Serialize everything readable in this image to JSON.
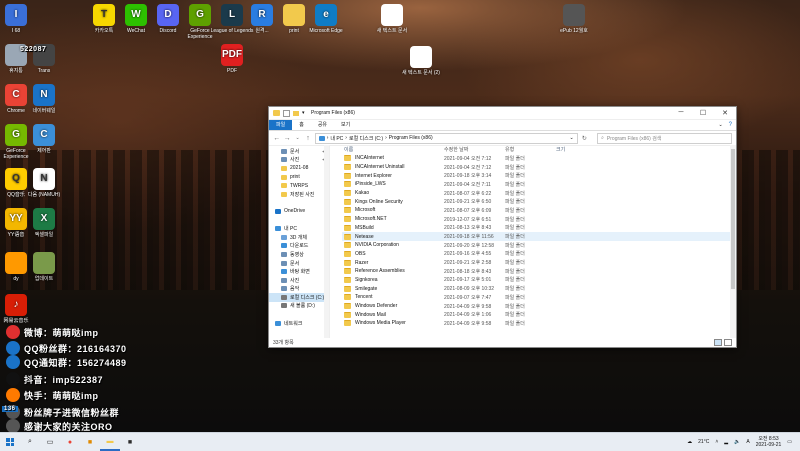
{
  "desktop": {
    "icons": [
      {
        "label": "I 68",
        "color": "#3a6fd8",
        "glyph": "I"
      },
      {
        "label": "카카오톡",
        "color": "#f7d700",
        "glyph": "T"
      },
      {
        "label": "WeChat",
        "color": "#2dc100",
        "glyph": "W"
      },
      {
        "label": "Discord",
        "color": "#5865f2",
        "glyph": "D"
      },
      {
        "label": "GeForce Experience",
        "color": "#5ea000",
        "glyph": "G"
      },
      {
        "label": "League of Legends",
        "color": "#1b3a4b",
        "glyph": "L"
      },
      {
        "label": "원격...",
        "color": "#2a7de1",
        "glyph": "R"
      },
      {
        "label": "print",
        "color": "#f2c94c",
        "glyph": ""
      },
      {
        "label": "Microsoft Edge",
        "color": "#0f7cc5",
        "glyph": "e"
      },
      {
        "label": "새 텍스트 문서",
        "color": "#ffffff",
        "glyph": ""
      },
      {
        "label": "ePub 12월호",
        "color": "#555555",
        "glyph": ""
      },
      {
        "label": "휴지통",
        "color": "#9aa7b5",
        "glyph": ""
      },
      {
        "label": "Trans",
        "color": "#444444",
        "glyph": ""
      },
      {
        "label": "PDF",
        "color": "#e02020",
        "glyph": "PDF"
      },
      {
        "label": "새 텍스트 문서 (2)",
        "color": "#ffffff",
        "glyph": ""
      },
      {
        "label": "Chrome",
        "color": "#ea4335",
        "glyph": "C"
      },
      {
        "label": "네이버웨일",
        "color": "#1a73c8",
        "glyph": "N"
      },
      {
        "label": "GeForce Experience",
        "color": "#76b900",
        "glyph": "G"
      },
      {
        "label": "제어판",
        "color": "#3b8fd8",
        "glyph": "C"
      },
      {
        "label": "QQ音乐",
        "color": "#ffcc00",
        "glyph": "Q"
      },
      {
        "label": "다움 (NAMUH)",
        "color": "#ffffff",
        "glyph": "N"
      },
      {
        "label": "YY语音",
        "color": "#f3b700",
        "glyph": "YY"
      },
      {
        "label": "엑셀파일",
        "color": "#1d7b45",
        "glyph": "X"
      },
      {
        "label": "dy",
        "color": "#ff9900",
        "glyph": ""
      },
      {
        "label": "업데이트",
        "color": "#7a9a4a",
        "glyph": ""
      },
      {
        "label": "网易云音乐",
        "color": "#d81e06",
        "glyph": "♪"
      }
    ],
    "overlay_lines": [
      "微博：萌萌哒imp",
      "QQ粉丝群：216164370",
      "QQ通知群：156274489",
      "抖音：imp522387",
      "快手：萌萌哒imp",
      "粉丝牌子进微信粉丝群",
      "感谢大家的关注ORO"
    ],
    "overlay_prefix": "136",
    "top_left_number": "522087"
  },
  "explorer": {
    "title": "Program Files (x86)",
    "ribbon_tabs": [
      "파일",
      "홈",
      "공유",
      "보기"
    ],
    "breadcrumb": [
      "내 PC",
      "로컬 디스크 (C:)",
      "Program Files (x86)"
    ],
    "search_placeholder": "Program Files (x86) 검색",
    "columns": {
      "name": "이름",
      "date": "수정한 날짜",
      "type": "유형",
      "size": "크기"
    },
    "nav_items": [
      {
        "label": "문서",
        "indent": 1,
        "pinned": true,
        "color": "#6c8fb5"
      },
      {
        "label": "사진",
        "indent": 1,
        "pinned": true,
        "color": "#6c8fb5"
      },
      {
        "label": "2021-08",
        "indent": 1,
        "pinned": false,
        "color": "#f2c94c"
      },
      {
        "label": "print",
        "indent": 1,
        "pinned": false,
        "color": "#f2c94c"
      },
      {
        "label": "TWRPS",
        "indent": 1,
        "pinned": false,
        "color": "#f2c94c"
      },
      {
        "label": "저장된 사진",
        "indent": 1,
        "pinned": false,
        "color": "#f2c94c"
      },
      {
        "label": "",
        "indent": 0,
        "pinned": false,
        "color": ""
      },
      {
        "label": "OneDrive",
        "indent": 0,
        "pinned": false,
        "color": "#1a73c8"
      },
      {
        "label": "",
        "indent": 0,
        "pinned": false,
        "color": ""
      },
      {
        "label": "내 PC",
        "indent": 0,
        "pinned": false,
        "color": "#3b8fd8"
      },
      {
        "label": "3D 개체",
        "indent": 1,
        "pinned": false,
        "color": "#6aa0d8"
      },
      {
        "label": "다운로드",
        "indent": 1,
        "pinned": false,
        "color": "#3b8fd8"
      },
      {
        "label": "동영상",
        "indent": 1,
        "pinned": false,
        "color": "#6c8fb5"
      },
      {
        "label": "문서",
        "indent": 1,
        "pinned": false,
        "color": "#6c8fb5"
      },
      {
        "label": "바탕 화면",
        "indent": 1,
        "pinned": false,
        "color": "#3b8fd8"
      },
      {
        "label": "사진",
        "indent": 1,
        "pinned": false,
        "color": "#6c8fb5"
      },
      {
        "label": "음악",
        "indent": 1,
        "pinned": false,
        "color": "#6c8fb5"
      },
      {
        "label": "로컬 디스크 (C:)",
        "indent": 1,
        "pinned": false,
        "color": "#777777",
        "selected": true
      },
      {
        "label": "새 볼륨 (D:)",
        "indent": 1,
        "pinned": false,
        "color": "#777777"
      },
      {
        "label": "",
        "indent": 0,
        "pinned": false,
        "color": ""
      },
      {
        "label": "네트워크",
        "indent": 0,
        "pinned": false,
        "color": "#3b8fd8"
      }
    ],
    "rows": [
      {
        "name": "INCAInternet",
        "date": "2021-09-04 오전 7:12",
        "type": "파일 폴더"
      },
      {
        "name": "INCAInternet Uninstall",
        "date": "2021-09-04 오전 7:12",
        "type": "파일 폴더"
      },
      {
        "name": "Internet Explorer",
        "date": "2021-09-18 오후 3:14",
        "type": "파일 폴더"
      },
      {
        "name": "iPinside_LWS",
        "date": "2021-09-04 오전 7:11",
        "type": "파일 폴더"
      },
      {
        "name": "Kakao",
        "date": "2021-08-07 오후 6:22",
        "type": "파일 폴더"
      },
      {
        "name": "Kings Online Security",
        "date": "2021-09-21 오후 6:50",
        "type": "파일 폴더"
      },
      {
        "name": "Microsoft",
        "date": "2021-08-07 오후 6:09",
        "type": "파일 폴더"
      },
      {
        "name": "Microsoft.NET",
        "date": "2019-12-07 오후 6:51",
        "type": "파일 폴더"
      },
      {
        "name": "MSBuild",
        "date": "2021-08-13 오후 8:43",
        "type": "파일 폴더"
      },
      {
        "name": "Netease",
        "date": "2021-09-18 오후 11:56",
        "type": "파일 폴더",
        "highlighted": true
      },
      {
        "name": "NVIDIA Corporation",
        "date": "2021-09-20 오후 12:58",
        "type": "파일 폴더"
      },
      {
        "name": "OBS",
        "date": "2021-09-16 오후 4:55",
        "type": "파일 폴더"
      },
      {
        "name": "Razer",
        "date": "2021-09-21 오후 2:58",
        "type": "파일 폴더"
      },
      {
        "name": "Reference Assemblies",
        "date": "2021-08-18 오후 8:43",
        "type": "파일 폴더"
      },
      {
        "name": "Signkorea",
        "date": "2021-09-17 오후 5:01",
        "type": "파일 폴더"
      },
      {
        "name": "Smilegate",
        "date": "2021-08-09 오후 10:32",
        "type": "파일 폴더"
      },
      {
        "name": "Tencent",
        "date": "2021-09-07 오후 7:47",
        "type": "파일 폴더"
      },
      {
        "name": "Windows Defender",
        "date": "2021-04-09 오후 9:58",
        "type": "파일 폴더"
      },
      {
        "name": "Windows Mail",
        "date": "2021-04-09 오후 1:06",
        "type": "파일 폴더"
      },
      {
        "name": "Windows Media Player",
        "date": "2021-04-09 오후 9:58",
        "type": "파일 폴더"
      }
    ],
    "status": "33개 항목"
  },
  "taskbar": {
    "temperature": "21°C",
    "time": "오전 8:53",
    "date": "2021-09-21",
    "apps": [
      {
        "name": "search-icon",
        "glyph": "⌕",
        "color": "#222222"
      },
      {
        "name": "task-view-icon",
        "glyph": "▭",
        "color": "#222222"
      },
      {
        "name": "chrome-icon",
        "glyph": "●",
        "color": "#ea4335"
      },
      {
        "name": "app-icon",
        "glyph": "■",
        "color": "#e08a00"
      },
      {
        "name": "file-explorer-icon",
        "glyph": "▬",
        "color": "#f2c94c",
        "active": true
      },
      {
        "name": "app-icon-2",
        "glyph": "■",
        "color": "#2c2c2c"
      }
    ]
  }
}
